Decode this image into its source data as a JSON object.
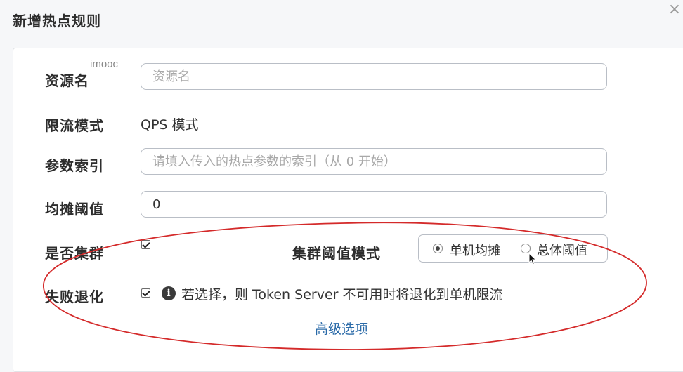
{
  "dialog": {
    "title": "新增热点规则",
    "close_glyph": "×"
  },
  "watermark": "imooc",
  "form": {
    "resource": {
      "label": "资源名",
      "placeholder": "资源名",
      "value": ""
    },
    "limit_mode": {
      "label": "限流模式",
      "value": "QPS 模式"
    },
    "param_index": {
      "label": "参数索引",
      "placeholder": "请填入传入的热点参数的索引（从 0 开始）",
      "value": ""
    },
    "threshold": {
      "label": "均摊阈值",
      "value": "0"
    },
    "cluster": {
      "label": "是否集群",
      "checked": true,
      "mode_label": "集群阈值模式",
      "options": [
        {
          "label": "单机均摊",
          "selected": true
        },
        {
          "label": "总体阈值",
          "selected": false
        }
      ]
    },
    "fallback": {
      "label": "失败退化",
      "checked": true,
      "info_glyph": "i",
      "hint": "若选择，则 Token Server 不可用时将退化到单机限流"
    },
    "advanced_link": "高级选项"
  },
  "colors": {
    "annotation": "#d42a2a",
    "link": "#2a6aa8"
  }
}
